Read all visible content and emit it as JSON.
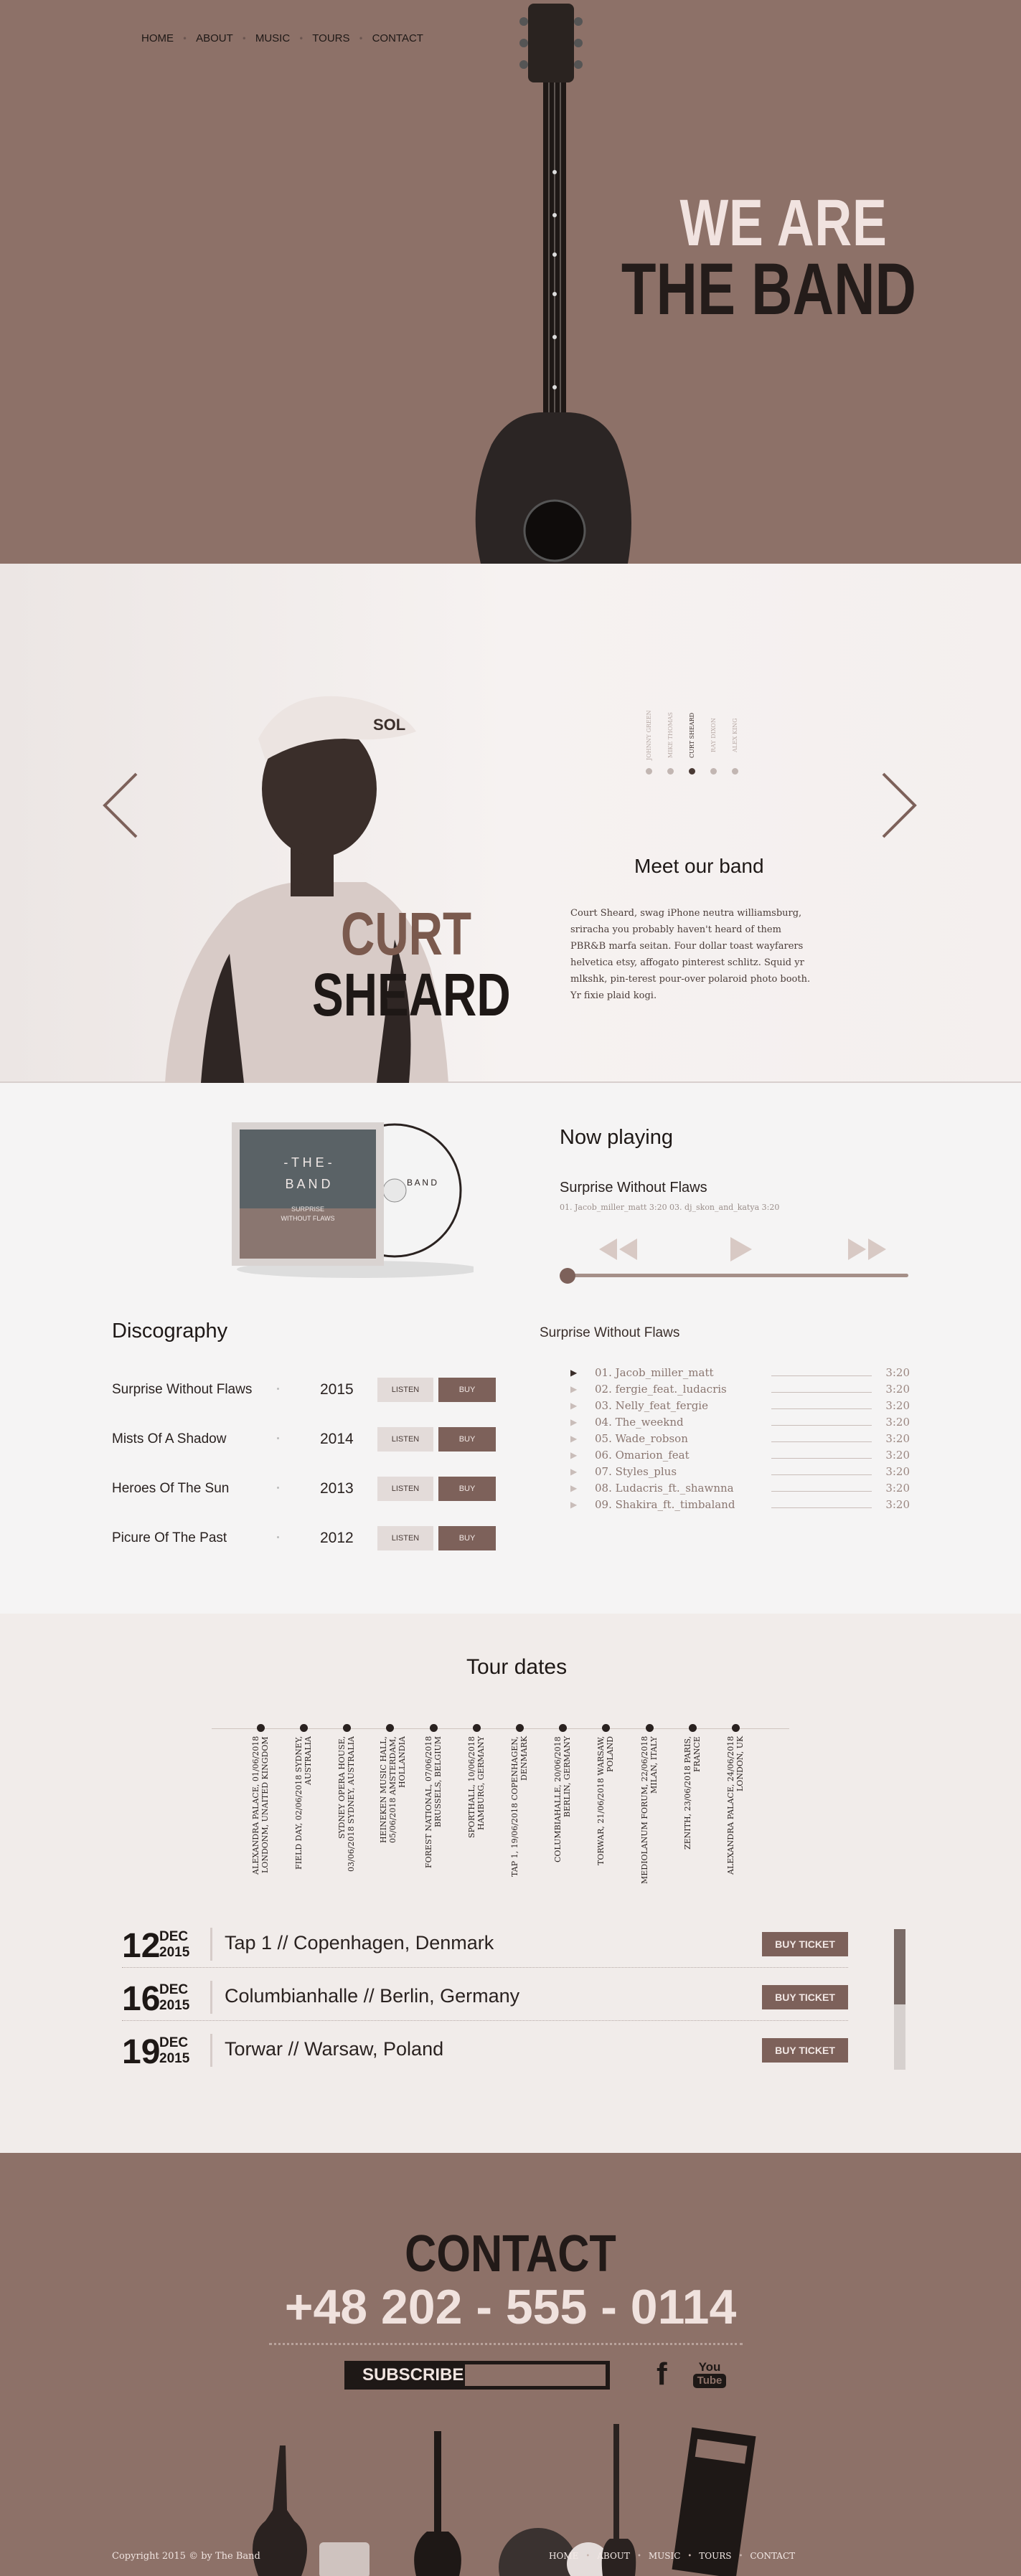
{
  "nav": {
    "items": [
      "HOME",
      "ABOUT",
      "MUSIC",
      "TOURS",
      "CONTACT"
    ]
  },
  "hero": {
    "title_line1": "WE ARE",
    "title_line2": "THE BAND"
  },
  "member": {
    "first_name": "CURT",
    "last_name": "SHEARD",
    "heading": "Meet our band",
    "text": "Court Sheard, swag iPhone neutra williamsburg, sriracha you probably haven't heard of them PBR&B marfa seitan. Four dollar toast wayfarers helvetica etsy, affogato pinterest schlitz. Squid yr mlkshk, pin-terest pour-over polaroid photo booth. Yr fixie plaid kogi.",
    "dots": [
      "JOHNNY GREEN",
      "MIKE THOMAS",
      "CURT SHEARD",
      "RAY DIXON",
      "ALEX KING"
    ],
    "active_dot": 2
  },
  "now_playing": {
    "title": "Now playing",
    "song": "Surprise Without Flaws",
    "subtitle": "01. Jacob_miller_matt 3:20 03. dj_skon_and_katya 3:20",
    "progress": 0,
    "album_title": "- T H E -\nB A N D",
    "album_sub": "SURPRISE\nWITHOUT FLAWS",
    "cd_text": "T H E\nB A N D"
  },
  "discography": {
    "title": "Discography",
    "listen_label": "LISTEN",
    "buy_label": "BUY",
    "albums": [
      {
        "name": "Surprise Without Flaws",
        "year": "2015"
      },
      {
        "name": "Mists Of A Shadow",
        "year": "2014"
      },
      {
        "name": "Heroes Of The Sun",
        "year": "2013"
      },
      {
        "name": "Picure Of The Past",
        "year": "2012"
      }
    ]
  },
  "tracklist": {
    "title": "Surprise Without Flaws",
    "play_icon": "play-icon",
    "tracks": [
      {
        "name": "01. Jacob_miller_matt",
        "time": "3:20"
      },
      {
        "name": "02. fergie_feat._ludacris",
        "time": "3:20"
      },
      {
        "name": "03. Nelly_feat_fergie",
        "time": "3:20"
      },
      {
        "name": "04. The_weeknd",
        "time": "3:20"
      },
      {
        "name": "05. Wade_robson",
        "time": "3:20"
      },
      {
        "name": "06. Omarion_feat",
        "time": "3:20"
      },
      {
        "name": "07. Styles_plus",
        "time": "3:20"
      },
      {
        "name": "08. Ludacris_ft._shawnna",
        "time": "3:20"
      },
      {
        "name": "09. Shakira_ft._timbaland",
        "time": "3:20"
      }
    ]
  },
  "tour": {
    "title": "Tour dates",
    "timeline": [
      "ALEXANDRA PALACE, 01/06/2018 LONDONM, UNAITED KINGDOM",
      "FIELD DAY, 02/06/2018 SYDNEY, AUSTRALIA",
      "SYDNEY OPERA HOUSE, 03/06/2018 SYDNEY, AUSTRALIA",
      "HEINEKEN MUSIC HALL, 05/06/2018 AMSTERDAM, HOLLANDIA",
      "FOREST NATIONAL, 07/06/2018 BRUSSELS, BELGIUM",
      "SPORTHALL, 10/06/2018 HAMBURG, GERMANY",
      "TAP 1, 19/06/2018 COPENHAGEN, DENMARK",
      "COLUMBIAHALLE, 20/06/2018 BERLIN, GERMANY",
      "TORWAR, 21/06/2018 WARSAW, POLAND",
      "MEDIOLANUM FORUM, 22/06/2018 MILAN, ITALY",
      "ZENITH, 23/06/2018 PARIS, FRANCE",
      "ALEXANDRA PALACE, 24/06/2018 LONDON, UK"
    ],
    "buy_label": "BUY TICKET",
    "dates": [
      {
        "day": "12",
        "month": "DEC",
        "year": "2015",
        "venue": "Tap 1 // Copenhagen, Denmark"
      },
      {
        "day": "16",
        "month": "DEC",
        "year": "2015",
        "venue": "Columbianhalle // Berlin, Germany"
      },
      {
        "day": "19",
        "month": "DEC",
        "year": "2015",
        "venue": "Torwar // Warsaw, Poland"
      }
    ]
  },
  "contact": {
    "title": "CONTACT",
    "phone": "+48 202 - 555 - 0114",
    "subscribe_label": "SUBSCRIBE",
    "subscribe_placeholder": "",
    "facebook_icon": "facebook-icon",
    "youtube_you": "You",
    "youtube_tube": "Tube"
  },
  "footer": {
    "copyright": "Copyright 2015 © by The Band",
    "nav": [
      "HOME",
      "ABOUT",
      "MUSIC",
      "TOURS",
      "CONTACT"
    ]
  },
  "colors": {
    "brand": "#8d7168",
    "accent": "#7d615a",
    "dark": "#1e1816"
  }
}
